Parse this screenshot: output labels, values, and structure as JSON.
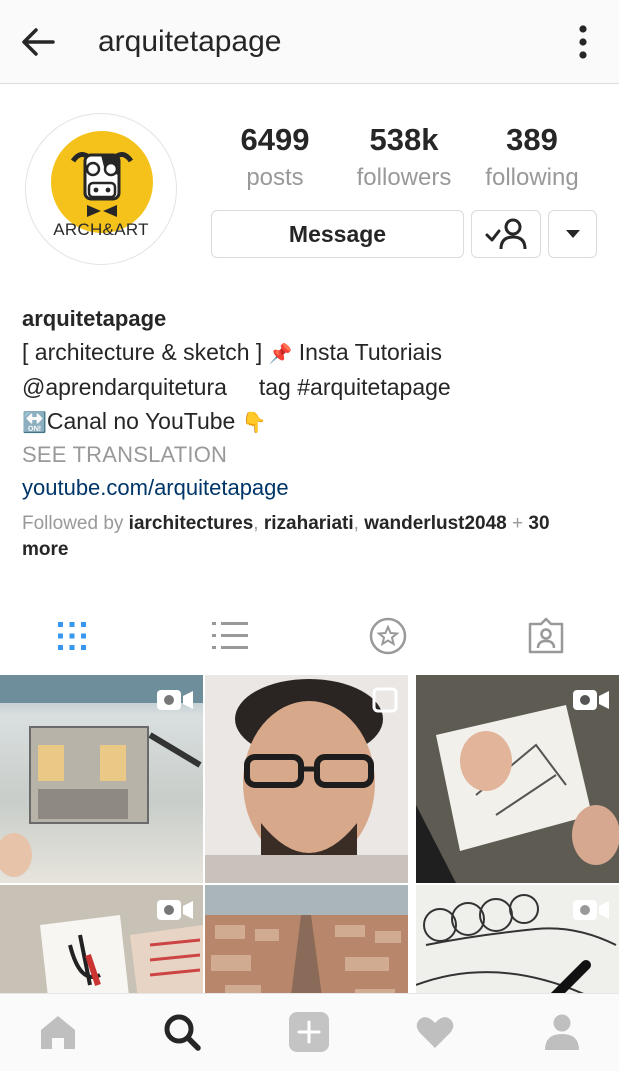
{
  "header": {
    "title": "arquitetapage",
    "back_icon": "arrow-left-icon",
    "menu_icon": "more-vertical-icon"
  },
  "profile": {
    "avatar_text": "ARCH&ART",
    "stats": [
      {
        "value": "6499",
        "label": "posts"
      },
      {
        "value": "538k",
        "label": "followers"
      },
      {
        "value": "389",
        "label": "following"
      }
    ],
    "message_label": "Message",
    "bio": {
      "name": "arquitetapage",
      "line1": "[ architecture & sketch ]",
      "line1_pin": "📌",
      "line1_rest": "Insta Tutoriais",
      "line2": "@aprendarquitetura     tag #arquitetapage",
      "line3_emoji": "🔛",
      "line3": "Canal no YouTube",
      "line3_hand": "👇",
      "translation": "SEE TRANSLATION",
      "link": "youtube.com/arquitetapage"
    },
    "followed_by": {
      "prefix": "Followed by ",
      "users": [
        "iarchitectures",
        "rizahariati",
        "wanderlust2048"
      ],
      "sep": ", ",
      "plus": " + ",
      "more": "30 more"
    }
  },
  "tabs": [
    "grid-icon",
    "list-icon",
    "saved-icon",
    "tagged-icon"
  ],
  "posts": [
    {
      "type": "video",
      "desc": "watercolor building sketch"
    },
    {
      "type": "multiple",
      "desc": "portrait of man with glasses"
    },
    {
      "type": "video",
      "desc": "hands sketching in notebook"
    },
    {
      "type": "video",
      "desc": "hand drawing"
    },
    {
      "type": "image",
      "desc": "aerial city view"
    },
    {
      "type": "video",
      "desc": "pen drawing spirals"
    }
  ],
  "nav": [
    "home-icon",
    "search-icon",
    "add-icon",
    "heart-icon",
    "profile-icon"
  ],
  "colors": {
    "link": "#003569",
    "muted": "#999999",
    "accent": "#3897f0",
    "avatar_yellow": "#f4c21a"
  }
}
